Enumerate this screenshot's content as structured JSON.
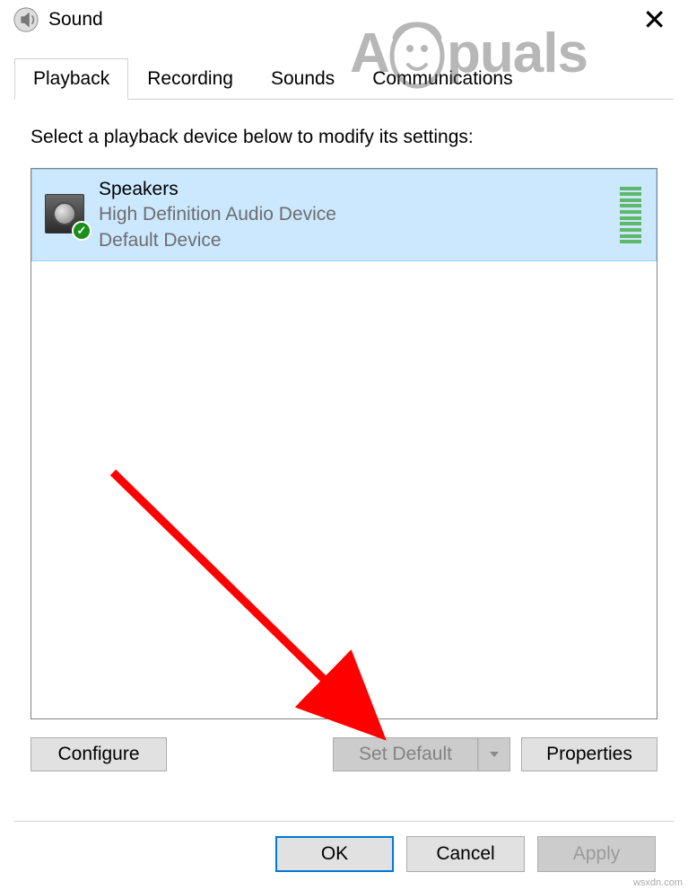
{
  "window": {
    "title": "Sound"
  },
  "tabs": {
    "items": [
      {
        "label": "Playback",
        "active": true
      },
      {
        "label": "Recording",
        "active": false
      },
      {
        "label": "Sounds",
        "active": false
      },
      {
        "label": "Communications",
        "active": false
      }
    ]
  },
  "content": {
    "instruction": "Select a playback device below to modify its settings:"
  },
  "devices": [
    {
      "name": "Speakers",
      "description": "High Definition Audio Device",
      "status": "Default Device",
      "isDefault": true
    }
  ],
  "buttons": {
    "configure": "Configure",
    "setDefault": "Set Default",
    "properties": "Properties",
    "ok": "OK",
    "cancel": "Cancel",
    "apply": "Apply"
  },
  "watermark": {
    "text_left": "A",
    "text_right": "puals"
  },
  "footer_mark": "wsxdn.com"
}
